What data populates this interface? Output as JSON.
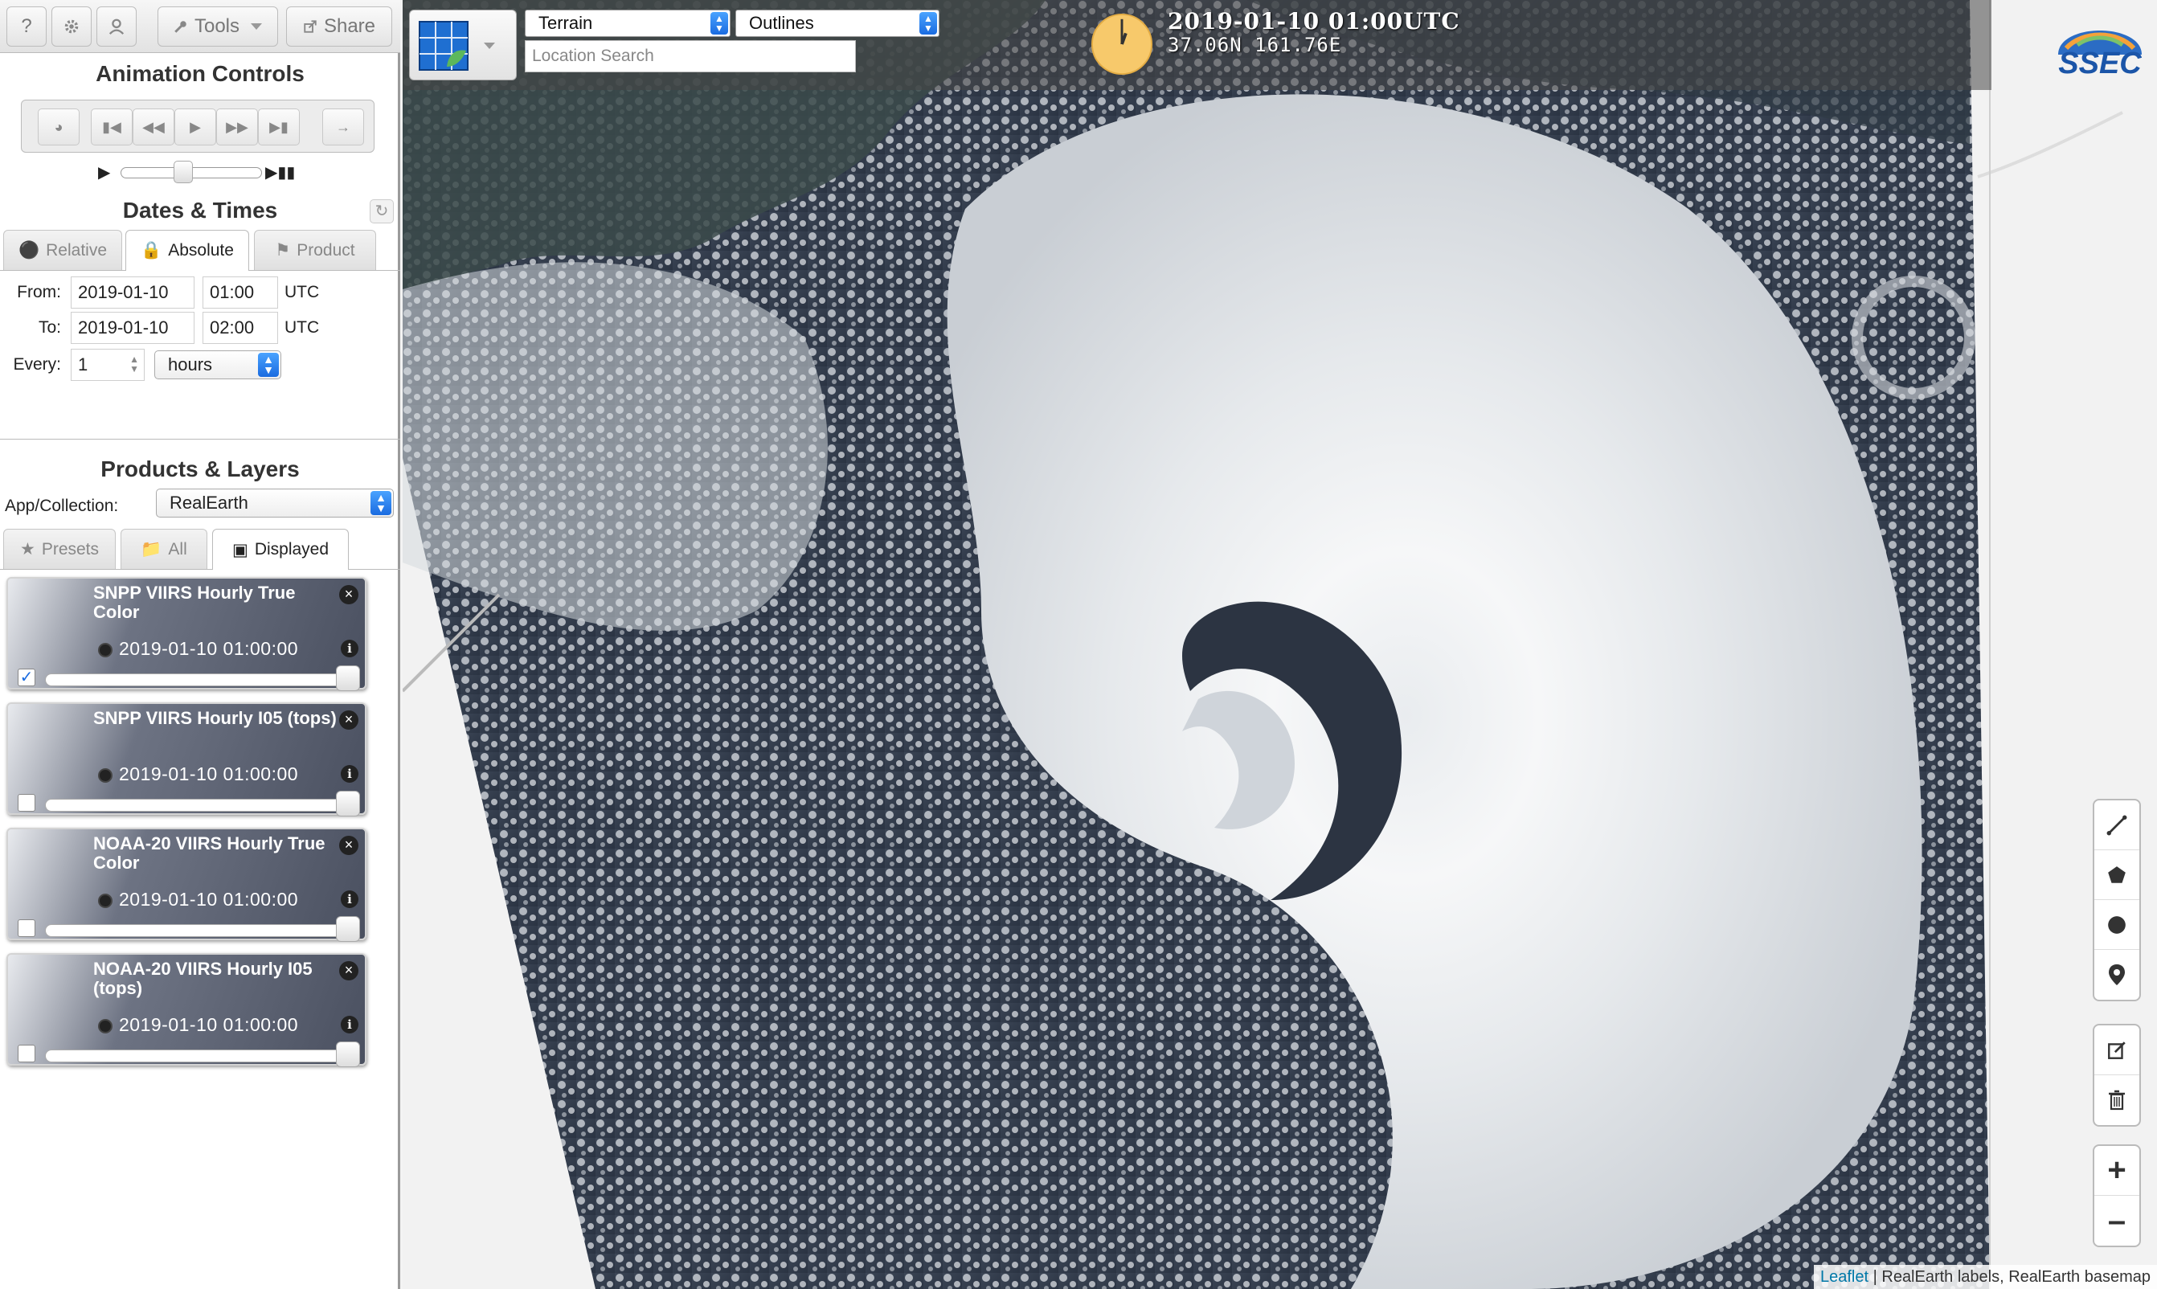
{
  "toolbar": {
    "help_label": "?",
    "tools_label": "Tools",
    "share_label": "Share"
  },
  "animation": {
    "title": "Animation Controls"
  },
  "dates": {
    "title": "Dates & Times",
    "tabs": [
      {
        "label": "Relative",
        "active": false
      },
      {
        "label": "Absolute",
        "active": true
      },
      {
        "label": "Product",
        "active": false
      }
    ],
    "from_label": "From:",
    "from_date": "2019-01-10",
    "from_time": "01:00",
    "to_label": "To:",
    "to_date": "2019-01-10",
    "to_time": "02:00",
    "tz": "UTC",
    "every_label": "Every:",
    "every_value": "1",
    "every_unit": "hours"
  },
  "products": {
    "title": "Products & Layers",
    "collection_label": "App/Collection:",
    "collection_value": "RealEarth",
    "tabs": [
      {
        "label": "Presets",
        "active": false
      },
      {
        "label": "All",
        "active": false
      },
      {
        "label": "Displayed",
        "active": true
      }
    ],
    "layers": [
      {
        "title": "SNPP VIIRS Hourly True Color",
        "time": "2019-01-10 01:00:00",
        "checked": true,
        "opacity": 1.0
      },
      {
        "title": "SNPP VIIRS Hourly I05 (tops)",
        "time": "2019-01-10 01:00:00",
        "checked": false,
        "opacity": 1.0
      },
      {
        "title": "NOAA-20 VIIRS Hourly True Color",
        "time": "2019-01-10 01:00:00",
        "checked": false,
        "opacity": 1.0
      },
      {
        "title": "NOAA-20 VIIRS Hourly I05 (tops)",
        "time": "2019-01-10 01:00:00",
        "checked": false,
        "opacity": 1.0
      }
    ]
  },
  "map": {
    "basemap_select": "Terrain",
    "overlay_select": "Outlines",
    "search_placeholder": "Location Search",
    "datetime": "2019-01-10 01:00UTC",
    "coords": "37.06N 161.76E",
    "logo_text": "SSEC",
    "attribution_link": "Leaflet",
    "attribution_text": " | RealEarth labels, RealEarth basemap"
  },
  "colors": {
    "accent": "#1a6be0",
    "clock_face": "#f7c96b"
  }
}
